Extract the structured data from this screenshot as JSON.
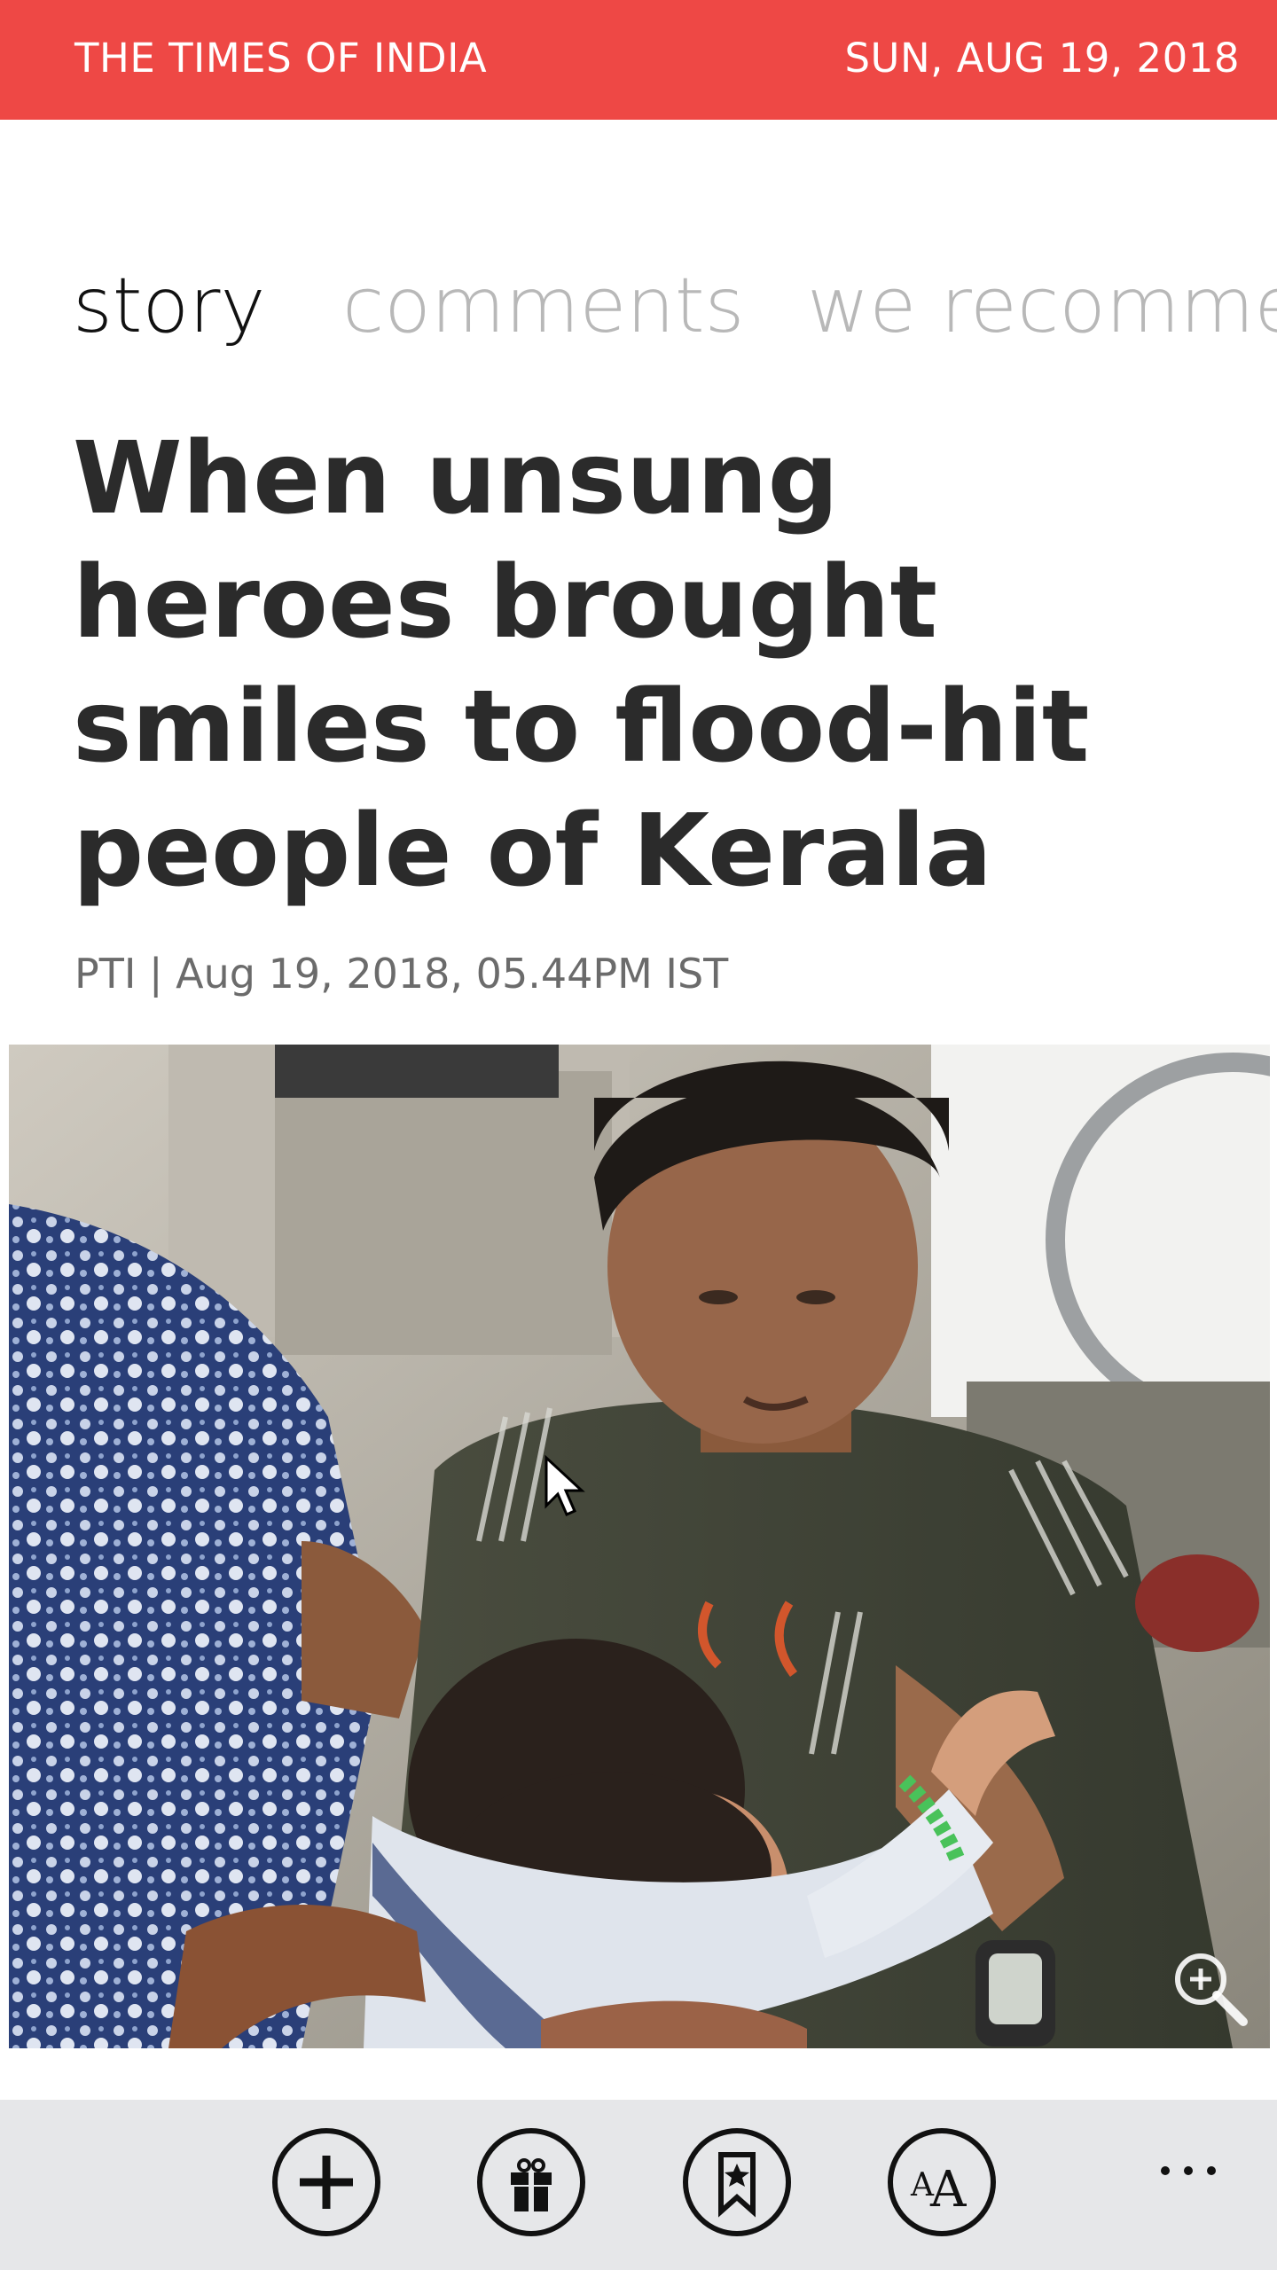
{
  "header": {
    "brand": "THE TIMES OF INDIA",
    "date": "SUN, AUG 19, 2018",
    "background_color": "#ee4845"
  },
  "tabs": [
    {
      "label": "story",
      "active": true
    },
    {
      "label": "comments",
      "active": false
    },
    {
      "label": "we recommend",
      "active": false
    }
  ],
  "article": {
    "headline": "When unsung heroes brought smiles to flood-hit people of Kerala",
    "byline": "PTI | Aug 19, 2018, 05.44PM IST",
    "photo": {
      "icon": "zoom-in-icon"
    }
  },
  "appbar": {
    "buttons": [
      {
        "icon": "add-icon"
      },
      {
        "icon": "gift-icon"
      },
      {
        "icon": "bookmark-icon"
      },
      {
        "icon": "font-size-icon"
      }
    ],
    "more_icon": "more-ellipsis-icon"
  }
}
